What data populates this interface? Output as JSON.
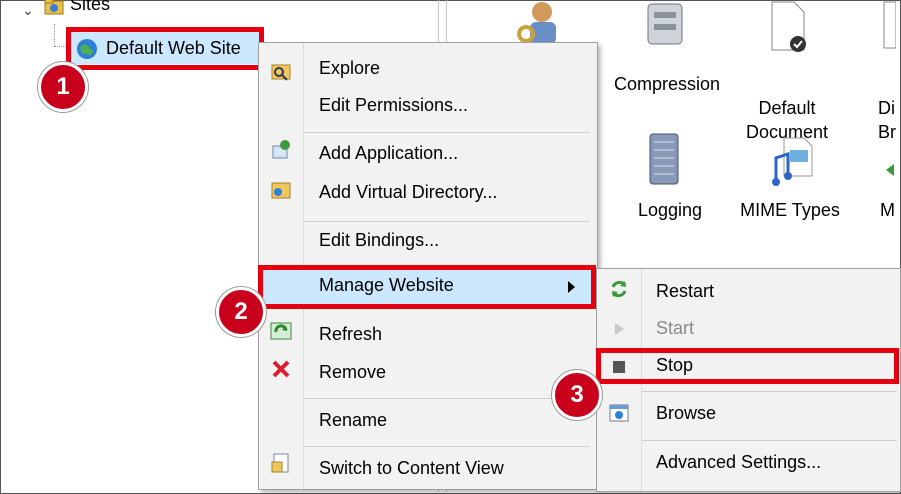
{
  "tree": {
    "parent_label": "Sites",
    "selected_label": "Default Web Site"
  },
  "features": [
    {
      "label": "Compression"
    },
    {
      "label": "Default\nDocument"
    },
    {
      "label": "Di\nBr"
    },
    {
      "label": "Logging"
    },
    {
      "label": "MIME Types"
    },
    {
      "label": "M"
    }
  ],
  "context_menu": {
    "explore": "Explore",
    "edit_permissions": "Edit Permissions...",
    "add_application": "Add Application...",
    "add_virtual_directory": "Add Virtual Directory...",
    "edit_bindings": "Edit Bindings...",
    "manage_website": "Manage Website",
    "refresh": "Refresh",
    "remove": "Remove",
    "rename": "Rename",
    "switch_content_view": "Switch to Content View"
  },
  "submenu": {
    "restart": "Restart",
    "start": "Start",
    "stop": "Stop",
    "browse": "Browse",
    "advanced_settings": "Advanced Settings..."
  },
  "badges": [
    "1",
    "2",
    "3"
  ],
  "colors": {
    "highlight_red": "#e4000f",
    "badge_red": "#c8001c",
    "menu_bg": "#f2f2f2",
    "hover_blue": "#cce8ff"
  }
}
